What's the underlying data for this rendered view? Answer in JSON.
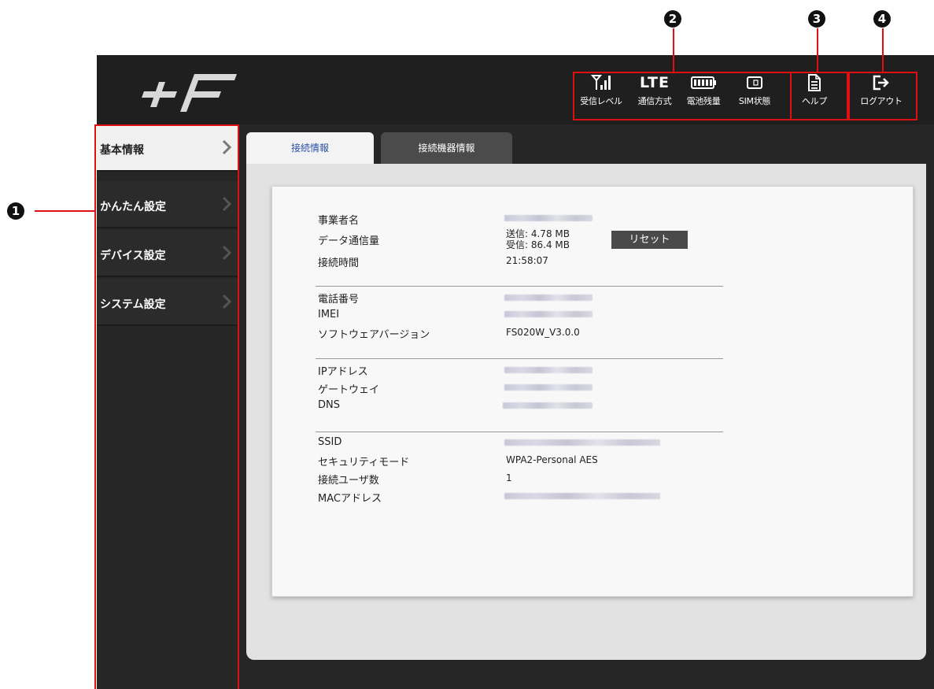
{
  "callouts": {
    "one": "1",
    "two": "2",
    "three": "3",
    "four": "4"
  },
  "header": {
    "logo_text": "+F",
    "status": [
      {
        "icon": "signal-icon",
        "label": "受信レベル"
      },
      {
        "icon": "lte-icon",
        "label": "通信方式",
        "icon_text": "LTE"
      },
      {
        "icon": "battery-icon",
        "label": "電池残量"
      },
      {
        "icon": "sim-icon",
        "label": "SIM状態"
      }
    ],
    "help_label": "ヘルプ",
    "logout_label": "ログアウト"
  },
  "sidebar": {
    "items": [
      {
        "label": "基本情報",
        "active": true
      },
      {
        "label": "かんたん設定",
        "active": false
      },
      {
        "label": "デバイス設定",
        "active": false
      },
      {
        "label": "システム設定",
        "active": false
      }
    ]
  },
  "tabs": [
    {
      "label": "接続情報",
      "active": true
    },
    {
      "label": "接続機器情報",
      "active": false
    }
  ],
  "info": {
    "carrier_label": "事業者名",
    "data_label": "データ通信量",
    "sent": "送信: 4.78 MB",
    "received": "受信: 86.4 MB",
    "reset_label": "リセット",
    "time_label": "接続時間",
    "time_value": "21:58:07",
    "phone_label": "電話番号",
    "imei_label": "IMEI",
    "sw_label": "ソフトウェアバージョン",
    "sw_value": "FS020W_V3.0.0",
    "ip_label": "IPアドレス",
    "gw_label": "ゲートウェイ",
    "dns_label": "DNS",
    "ssid_label": "SSID",
    "security_label": "セキュリティモード",
    "security_value": "WPA2-Personal AES",
    "users_label": "接続ユーザ数",
    "users_value": "1",
    "mac_label": "MACアドレス"
  },
  "colors": {
    "callout_red": "#e01010",
    "header_bg": "#1f1f1f",
    "link_blue": "#2b4fa8"
  }
}
